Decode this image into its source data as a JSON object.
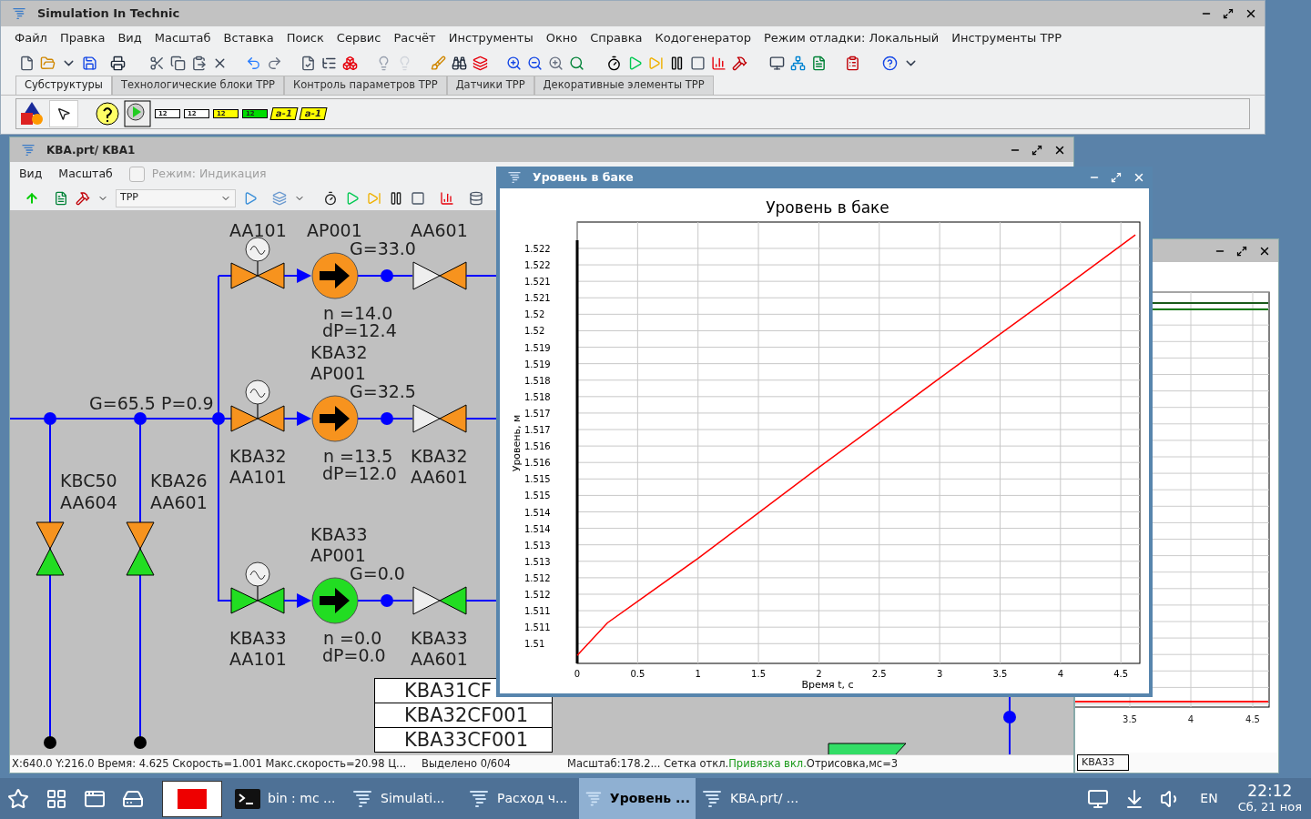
{
  "main_window": {
    "title": "Simulation In Technic",
    "menu": [
      "Файл",
      "Правка",
      "Вид",
      "Масштаб",
      "Вставка",
      "Поиск",
      "Сервис",
      "Расчёт",
      "Инструменты",
      "Окно",
      "Справка",
      "Кодогенератор",
      "Режим отладки: Локальный",
      "Инструменты TPP"
    ],
    "tabs": [
      {
        "label": "Субструктуры",
        "selected": true
      },
      {
        "label": "Технологические блоки TPP",
        "selected": false
      },
      {
        "label": "Контроль параметров TPP",
        "selected": false
      },
      {
        "label": "Датчики TPP",
        "selected": false
      },
      {
        "label": "Декоративные элементы TPP",
        "selected": false
      }
    ],
    "palette": [
      {
        "kind": "block",
        "label": "12",
        "color": "#ffffff"
      },
      {
        "kind": "block",
        "label": "12",
        "color": "#ffffff"
      },
      {
        "kind": "block",
        "label": "12",
        "color": "#ffff00"
      },
      {
        "kind": "block",
        "label": "12",
        "color": "#00dd00"
      },
      {
        "kind": "tag",
        "label": "a-1",
        "color": "#ffff00"
      },
      {
        "kind": "tag",
        "label": "a-1",
        "color": "#ffff00"
      }
    ]
  },
  "scheme_window": {
    "title": "KBA.prt/ KBA1",
    "menu": [
      "Вид",
      "Масштаб"
    ],
    "mode": {
      "label": "Режим: Индикация",
      "checked": false,
      "disabled": true
    },
    "layer_select": {
      "value": "TPP"
    },
    "diagram": {
      "header": {
        "flow": "G=65.5",
        "pressure": "P=0.9"
      },
      "drains": [
        {
          "tag": [
            "KBC50",
            "AA604"
          ]
        },
        {
          "tag": [
            "KBA26",
            "AA601"
          ]
        }
      ],
      "lines": [
        {
          "valve_tag": [
            "AA101"
          ],
          "pump_tag": [
            "AP001"
          ],
          "outlet_tag": [
            "AA601"
          ],
          "flow": "G=33.0",
          "speed": "n =14.0",
          "pressure_drop": "dP=12.4",
          "running": true
        },
        {
          "valve_tag": [
            "KBA32",
            "AA101"
          ],
          "pump_tag": [
            "KBA32",
            "AP001"
          ],
          "outlet_tag": [
            "KBA32",
            "AA601"
          ],
          "flow": "G=32.5",
          "speed": "n =13.5",
          "pressure_drop": "dP=12.0",
          "running": true
        },
        {
          "valve_tag": [
            "KBA33",
            "AA101"
          ],
          "pump_tag": [
            "KBA33",
            "AP001"
          ],
          "outlet_tag": [
            "KBA33",
            "AA601"
          ],
          "flow": "G=0.0",
          "speed": "n =0.0",
          "pressure_drop": "dP=0.0",
          "running": false
        }
      ],
      "table": [
        "KBA31CF",
        "KBA32CF001",
        "KBA33CF001"
      ]
    },
    "status_bar": {
      "position": "X:640.0  Y:216.0 Время: 4.625 Скорость=1.001 Макс.скорость=20.98 Ц...",
      "selection": "Выделено 0/604",
      "flags": [
        {
          "text": "Масштаб:178.2... Сетка откл.",
          "highlight": false
        },
        {
          "text": "Привязка вкл.",
          "highlight": true
        },
        {
          "text": "Отрисовка,мс=3",
          "highlight": false
        }
      ]
    }
  },
  "chart_window": {
    "title": "Уровень в баке",
    "chart_data": {
      "type": "line",
      "grid": true,
      "title": "Уровень в баке",
      "xlabel": "Время t, с",
      "ylabel": "Уровень, м",
      "x": [
        0,
        0.25,
        0.5,
        1,
        1.5,
        2,
        2.5,
        3,
        3.5,
        4,
        4.62
      ],
      "series": [
        {
          "color": "#ff0000",
          "values": [
            1.50964,
            1.51063,
            1.51128,
            1.51259,
            1.51397,
            1.51535,
            1.5167,
            1.51806,
            1.5194,
            1.52073,
            1.52241
          ]
        }
      ],
      "xlim": [
        0,
        4.657
      ],
      "ylim": [
        1.5094,
        1.5228
      ],
      "xticks": [
        0,
        0.5,
        1,
        1.5,
        2,
        2.5,
        3,
        3.5,
        4,
        4.5
      ],
      "yticks": [
        {
          "value": 1.51,
          "label": "1.51"
        },
        {
          "value": 1.5105,
          "label": "1.511"
        },
        {
          "value": 1.511,
          "label": "1.511"
        },
        {
          "value": 1.5115,
          "label": "1.512"
        },
        {
          "value": 1.512,
          "label": "1.512"
        },
        {
          "value": 1.5125,
          "label": "1.513"
        },
        {
          "value": 1.513,
          "label": "1.513"
        },
        {
          "value": 1.5135,
          "label": "1.514"
        },
        {
          "value": 1.514,
          "label": "1.514"
        },
        {
          "value": 1.5145,
          "label": "1.515"
        },
        {
          "value": 1.515,
          "label": "1.515"
        },
        {
          "value": 1.5155,
          "label": "1.516"
        },
        {
          "value": 1.516,
          "label": "1.516"
        },
        {
          "value": 1.5165,
          "label": "1.517"
        },
        {
          "value": 1.517,
          "label": "1.517"
        },
        {
          "value": 1.5175,
          "label": "1.518"
        },
        {
          "value": 1.518,
          "label": "1.518"
        },
        {
          "value": 1.5185,
          "label": "1.519"
        },
        {
          "value": 1.519,
          "label": "1.519"
        },
        {
          "value": 1.5195,
          "label": "1.52"
        },
        {
          "value": 1.52,
          "label": "1.52"
        },
        {
          "value": 1.5205,
          "label": "1.521"
        },
        {
          "value": 1.521,
          "label": "1.521"
        },
        {
          "value": 1.5215,
          "label": "1.522"
        },
        {
          "value": 1.522,
          "label": "1.522"
        }
      ]
    }
  },
  "background_window": {
    "x_tick_labels": [
      "3.5",
      "4",
      "4.5"
    ],
    "status": "KBA33"
  },
  "taskbar": {
    "tasks": [
      {
        "kind": "terminal",
        "label": "bin : mc ...",
        "selected": false
      },
      {
        "kind": "app",
        "label": "Simulati...",
        "selected": false
      },
      {
        "kind": "app",
        "label": "Расход ч...",
        "selected": false
      },
      {
        "kind": "app",
        "label": "Уровень ...",
        "selected": true
      },
      {
        "kind": "app",
        "label": "KBA.prt/ ...",
        "selected": false
      }
    ],
    "language": "EN",
    "time": "22:12",
    "date": "Сб, 21 ноя"
  }
}
